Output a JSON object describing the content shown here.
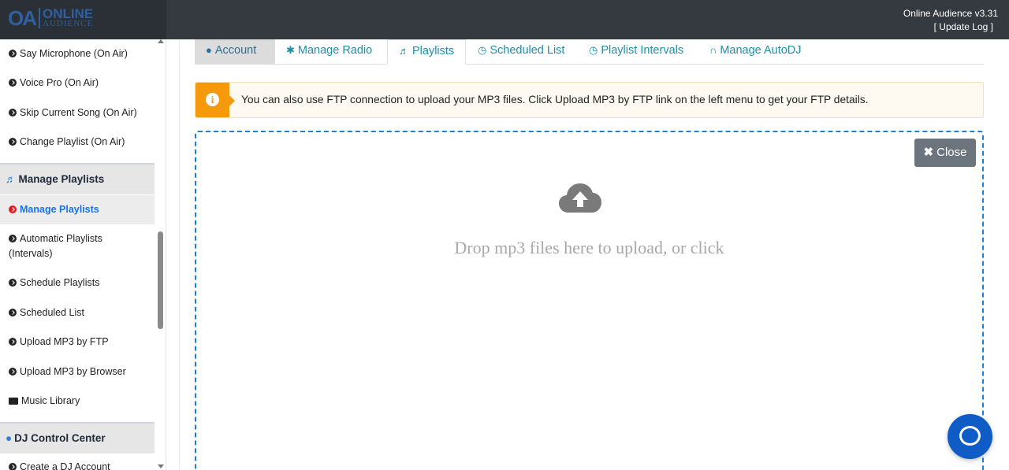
{
  "header": {
    "logo_mark": "OA",
    "logo_line1": "ONLINE",
    "logo_line2": "AUDIENCE",
    "version": "Online Audience v3.31",
    "update_log": "[ Update Log ]"
  },
  "sidebar": {
    "items_top": [
      {
        "label": "Say Microphone (On Air)"
      },
      {
        "label": "Voice Pro (On Air)"
      },
      {
        "label": "Skip Current Song (On Air)"
      },
      {
        "label": "Change Playlist (On Air)"
      }
    ],
    "section_playlists": "Manage Playlists",
    "items_playlists": [
      {
        "label": "Manage Playlists"
      },
      {
        "label": "Automatic Playlists"
      },
      {
        "label": "(Intervals)"
      },
      {
        "label": "Schedule Playlists"
      },
      {
        "label": "Scheduled List"
      },
      {
        "label": "Upload MP3 by FTP"
      },
      {
        "label": "Upload MP3 by Browser"
      },
      {
        "label": "Music Library"
      }
    ],
    "section_dj": "DJ Control Center",
    "items_dj": [
      {
        "label": "Create a DJ Account"
      }
    ]
  },
  "tabs": [
    {
      "label": "Account"
    },
    {
      "label": "Manage Radio"
    },
    {
      "label": "Playlists"
    },
    {
      "label": "Scheduled List"
    },
    {
      "label": "Playlist Intervals"
    },
    {
      "label": "Manage AutoDJ"
    }
  ],
  "alert": {
    "icon": "i",
    "text": "You can also use FTP connection to upload your MP3 files. Click Upload MP3 by FTP link on the left menu to get your FTP details."
  },
  "dropzone": {
    "close_label": "Close",
    "message": "Drop mp3 files here to upload, or click"
  },
  "colors": {
    "topbar": "#343a40",
    "accent_blue": "#1a82d6",
    "alert_orange": "#f59a0c",
    "active_bullet": "#e02020",
    "chat": "#0f5cc7"
  }
}
